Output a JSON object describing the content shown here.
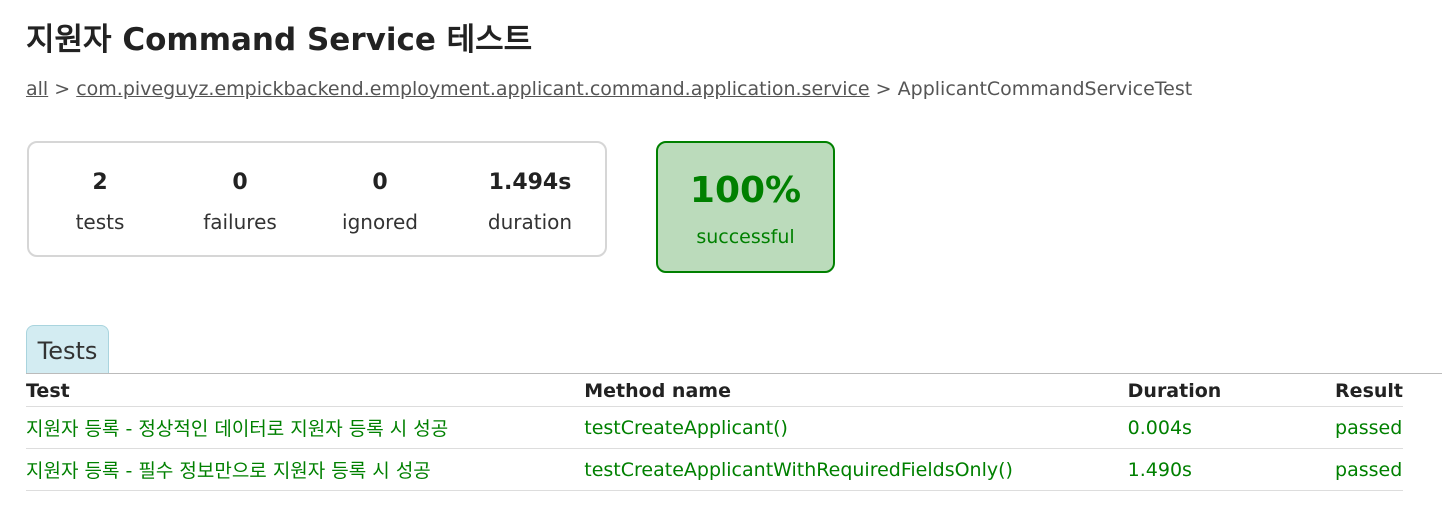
{
  "page": {
    "title": "지원자 Command Service 테스트"
  },
  "breadcrumb": {
    "root_link": "all",
    "separator1": ">",
    "package_link": "com.piveguyz.empickbackend.employment.applicant.command.application.service",
    "separator2": ">",
    "current": "ApplicantCommandServiceTest"
  },
  "summary": {
    "tests": {
      "value": "2",
      "label": "tests"
    },
    "failures": {
      "value": "0",
      "label": "failures"
    },
    "ignored": {
      "value": "0",
      "label": "ignored"
    },
    "duration": {
      "value": "1.494s",
      "label": "duration"
    },
    "success_rate": {
      "value": "100%",
      "label": "successful"
    }
  },
  "tabs": [
    {
      "label": "Tests",
      "active": true
    }
  ],
  "table": {
    "headers": [
      "Test",
      "Method name",
      "Duration",
      "Result"
    ],
    "rows": [
      {
        "test": "지원자 등록 - 정상적인 데이터로 지원자 등록 시 성공",
        "method": "testCreateApplicant()",
        "duration": "0.004s",
        "result": "passed"
      },
      {
        "test": "지원자 등록 - 필수 정보만으로 지원자 등록 시 성공",
        "method": "testCreateApplicantWithRequiredFieldsOnly()",
        "duration": "1.490s",
        "result": "passed"
      }
    ]
  },
  "colors": {
    "success_text": "#008000",
    "success_bg": "#bbdbbb",
    "tab_bg": "#d3ecf2",
    "border": "#d6d6d6"
  }
}
